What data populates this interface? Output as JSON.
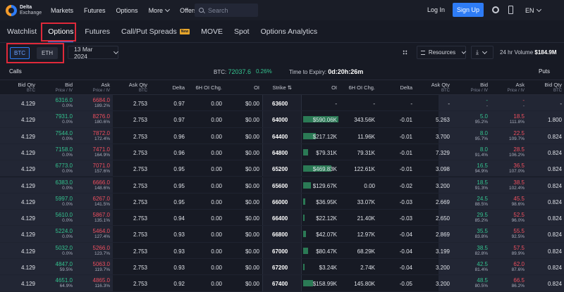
{
  "topbar": {
    "logo_line1": "Delta",
    "logo_line2": "Exchange",
    "nav": [
      {
        "label": "Markets"
      },
      {
        "label": "Futures"
      },
      {
        "label": "Options"
      },
      {
        "label": "More"
      },
      {
        "label": "Offers"
      }
    ],
    "search_placeholder": "Search",
    "login": "Log In",
    "signup": "Sign Up",
    "lang": "EN"
  },
  "tabs": [
    "Watchlist",
    "Options",
    "Futures",
    "Call/Put Spreads",
    "MOVE",
    "Spot",
    "Options Analytics"
  ],
  "new_badge": "New",
  "controls": {
    "asset_btc": "BTC",
    "asset_eth": "ETH",
    "date": "13 Mar 2024",
    "resources": "Resources",
    "volume_label": "24 hr Volume",
    "volume_value": "$184.9M"
  },
  "info": {
    "calls": "Calls",
    "puts": "Puts",
    "btc_label": "BTC:",
    "btc_price": "72037.6",
    "change": "0.26%",
    "expiry_label": "Time to Expiry:",
    "expiry_value": "0d:20h:26m"
  },
  "headers": {
    "bid_qty": "Bid Qty",
    "btc": "BTC",
    "bid": "Bid",
    "price_iv": "Price / IV",
    "ask": "Ask",
    "ask_qty": "Ask Qty",
    "delta": "Delta",
    "oi_chg": "6H OI Chg.",
    "oi": "OI",
    "strike": "Strike"
  },
  "rows": [
    {
      "cbq": "4.129",
      "cbid": "6316.0",
      "civ": "0.0%",
      "cask": "6684.0",
      "caiv": "189.2%",
      "caq": "2.753",
      "cd": "0.97",
      "coc": "0.00",
      "coi": "$0.00",
      "strike": "63600",
      "poi": "-",
      "poc": "-",
      "pd": "-",
      "paq": "-",
      "pask": "-",
      "paiv": "-",
      "pbid": "-",
      "pbiv": "-",
      "pbq": "-",
      "bar": 0
    },
    {
      "cbq": "4.129",
      "cbid": "7931.0",
      "civ": "0.0%",
      "cask": "8276.0",
      "caiv": "180.6%",
      "caq": "2.753",
      "cd": "0.97",
      "coc": "0.00",
      "coi": "$0.00",
      "strike": "64000",
      "poi": "$590.06K",
      "poc": "343.56K",
      "pd": "-0.01",
      "paq": "5.263",
      "pbid": "5.0",
      "pbiv": "95.2%",
      "pask": "18.5",
      "paiv": "111.8%",
      "pbq": "1.800",
      "bar": 50
    },
    {
      "cbq": "4.129",
      "cbid": "7544.0",
      "civ": "0.0%",
      "cask": "7872.0",
      "caiv": "172.4%",
      "caq": "2.753",
      "cd": "0.96",
      "coc": "0.00",
      "coi": "$0.00",
      "strike": "64400",
      "poi": "$217.12K",
      "poc": "11.96K",
      "pd": "-0.01",
      "paq": "3.700",
      "pbid": "8.0",
      "pbiv": "95.7%",
      "pask": "22.5",
      "paiv": "109.7%",
      "pbq": "0.824",
      "bar": 18
    },
    {
      "cbq": "4.129",
      "cbid": "7158.0",
      "civ": "0.0%",
      "cask": "7471.0",
      "caiv": "164.9%",
      "caq": "2.753",
      "cd": "0.96",
      "coc": "0.00",
      "coi": "$0.00",
      "strike": "64800",
      "poi": "$79.31K",
      "poc": "79.31K",
      "pd": "-0.01",
      "paq": "7.329",
      "pbid": "8.0",
      "pbiv": "91.4%",
      "pask": "28.5",
      "paiv": "106.2%",
      "pbq": "0.824",
      "bar": 7
    },
    {
      "cbq": "4.129",
      "cbid": "6773.0",
      "civ": "0.0%",
      "cask": "7071.0",
      "caiv": "157.6%",
      "caq": "2.753",
      "cd": "0.95",
      "coc": "0.00",
      "coi": "$0.00",
      "strike": "65200",
      "poi": "$469.83K",
      "poc": "122.61K",
      "pd": "-0.01",
      "paq": "3.098",
      "pbid": "16.5",
      "pbiv": "94.9%",
      "pask": "36.5",
      "paiv": "107.0%",
      "pbq": "0.824",
      "bar": 40
    },
    {
      "cbq": "4.129",
      "cbid": "6383.0",
      "civ": "0.0%",
      "cask": "6666.0",
      "caiv": "148.6%",
      "caq": "2.753",
      "cd": "0.95",
      "coc": "0.00",
      "coi": "$0.00",
      "strike": "65600",
      "poi": "$129.67K",
      "poc": "0.00",
      "pd": "-0.02",
      "paq": "3.200",
      "pbid": "18.5",
      "pbiv": "91.3%",
      "pask": "38.5",
      "paiv": "102.4%",
      "pbq": "0.824",
      "bar": 11
    },
    {
      "cbq": "4.129",
      "cbid": "5997.0",
      "civ": "0.0%",
      "cask": "6267.0",
      "caiv": "141.5%",
      "caq": "2.753",
      "cd": "0.95",
      "coc": "0.00",
      "coi": "$0.00",
      "strike": "66000",
      "poi": "$36.95K",
      "poc": "33.07K",
      "pd": "-0.03",
      "paq": "2.669",
      "pbid": "24.5",
      "pbiv": "88.5%",
      "pask": "45.5",
      "paiv": "98.6%",
      "pbq": "0.824",
      "bar": 3
    },
    {
      "cbq": "4.129",
      "cbid": "5610.0",
      "civ": "0.0%",
      "cask": "5867.0",
      "caiv": "135.1%",
      "caq": "2.753",
      "cd": "0.94",
      "coc": "0.00",
      "coi": "$0.00",
      "strike": "66400",
      "poi": "$22.12K",
      "poc": "21.40K",
      "pd": "-0.03",
      "paq": "2.650",
      "pbid": "29.5",
      "pbiv": "85.2%",
      "pask": "52.5",
      "paiv": "96.0%",
      "pbq": "0.824",
      "bar": 2
    },
    {
      "cbq": "4.129",
      "cbid": "5224.0",
      "civ": "0.0%",
      "cask": "5464.0",
      "caiv": "127.4%",
      "caq": "2.753",
      "cd": "0.93",
      "coc": "0.00",
      "coi": "$0.00",
      "strike": "66800",
      "poi": "$42.07K",
      "poc": "12.97K",
      "pd": "-0.04",
      "paq": "2.869",
      "pbid": "35.5",
      "pbiv": "83.8%",
      "pask": "55.5",
      "paiv": "92.5%",
      "pbq": "0.824",
      "bar": 4
    },
    {
      "cbq": "4.129",
      "cbid": "5032.0",
      "civ": "0.0%",
      "cask": "5266.0",
      "caiv": "123.7%",
      "caq": "2.753",
      "cd": "0.93",
      "coc": "0.00",
      "coi": "$0.00",
      "strike": "67000",
      "poi": "$80.47K",
      "poc": "68.29K",
      "pd": "-0.04",
      "paq": "3.199",
      "pbid": "38.5",
      "pbiv": "82.8%",
      "pask": "57.5",
      "paiv": "89.9%",
      "pbq": "0.824",
      "bar": 7
    },
    {
      "cbq": "4.129",
      "cbid": "4847.0",
      "civ": "59.5%",
      "cask": "5063.0",
      "caiv": "119.7%",
      "caq": "2.753",
      "cd": "0.93",
      "coc": "0.00",
      "coi": "$0.00",
      "strike": "67200",
      "poi": "$3.24K",
      "poc": "2.74K",
      "pd": "-0.04",
      "paq": "3.200",
      "pbid": "42.5",
      "pbiv": "81.4%",
      "pask": "62.0",
      "paiv": "87.6%",
      "pbq": "0.824",
      "bar": 1
    },
    {
      "cbq": "4.129",
      "cbid": "4651.0",
      "civ": "64.9%",
      "cask": "4865.0",
      "caiv": "116.3%",
      "caq": "2.753",
      "cd": "0.92",
      "coc": "0.00",
      "coi": "$0.00",
      "strike": "67400",
      "poi": "$158.99K",
      "poc": "145.80K",
      "pd": "-0.05",
      "paq": "3.200",
      "pbid": "48.5",
      "pbiv": "80.5%",
      "pask": "66.5",
      "paiv": "86.2%",
      "pbq": "0.824",
      "bar": 14
    }
  ]
}
